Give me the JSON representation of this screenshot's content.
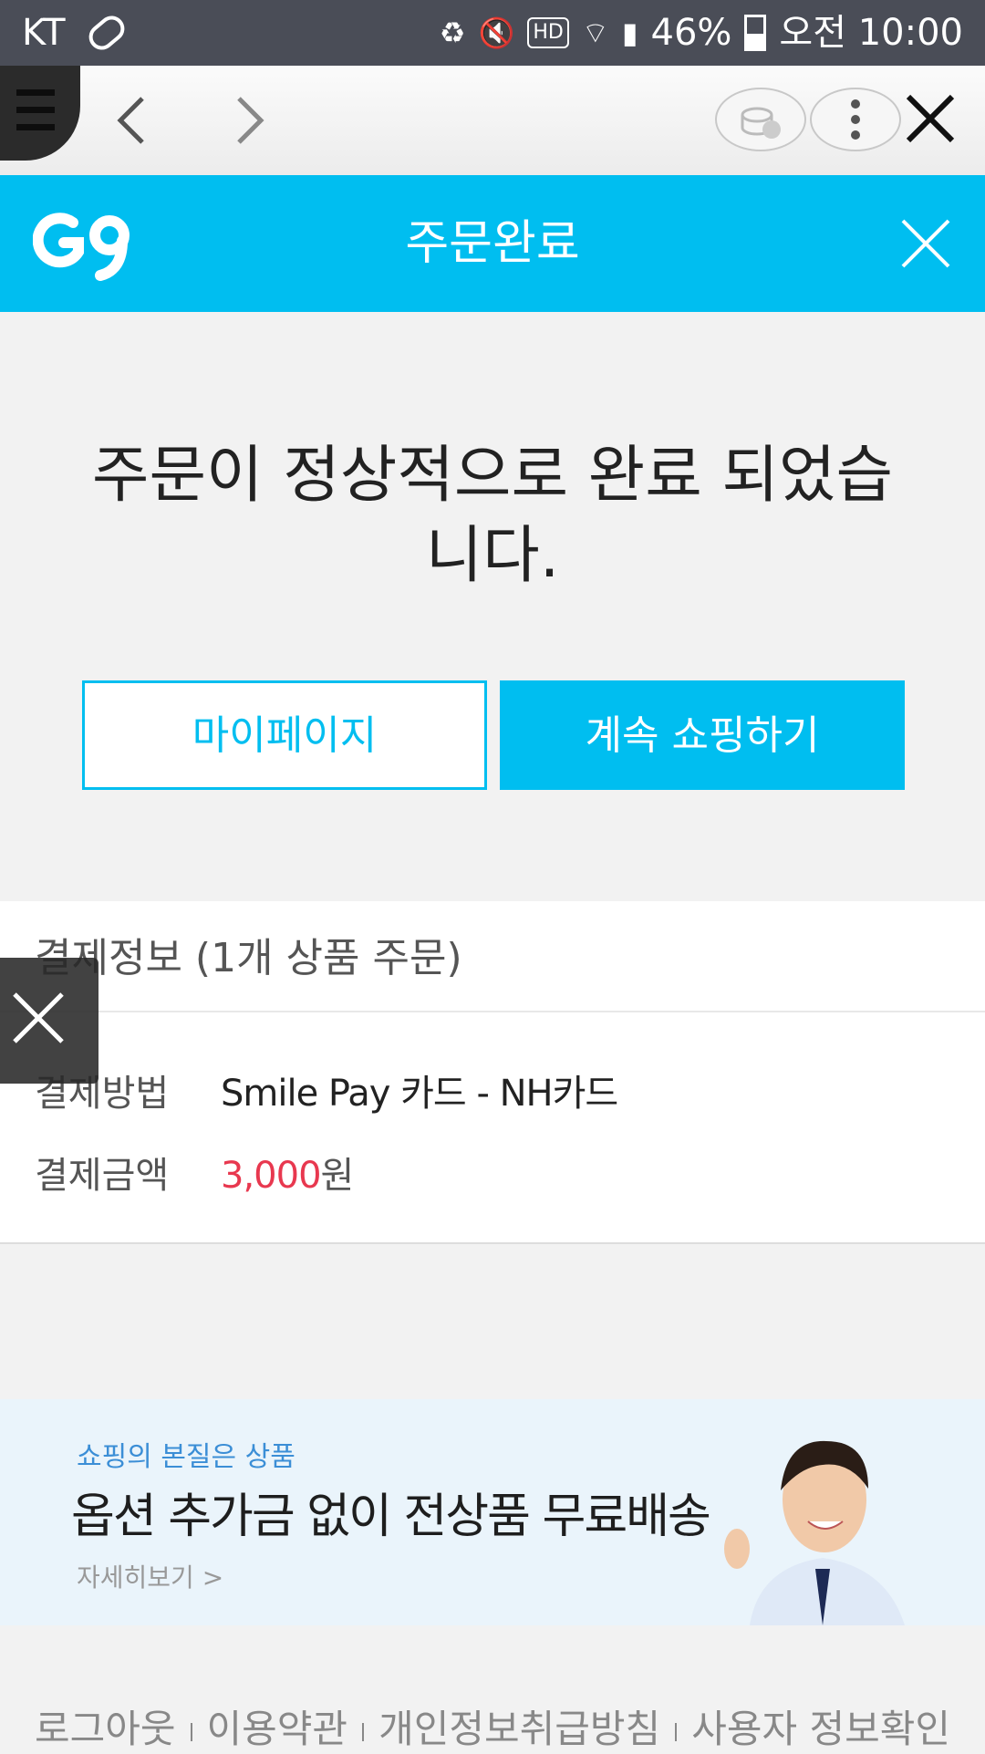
{
  "status": {
    "carrier": "KT",
    "battery": "46%",
    "time": "오전 10:00"
  },
  "header": {
    "logo": "G9",
    "title": "주문완료"
  },
  "message": "주문이 정상적으로 완료 되었습니다.",
  "buttons": {
    "mypage": "마이페이지",
    "continue": "계속 쇼핑하기"
  },
  "payment": {
    "title": "결제정보 (1개 상품 주문)",
    "method_label": "결제방법",
    "method_value": "Smile Pay 카드 - NH카드",
    "amount_label": "결제금액",
    "amount_value": "3,000",
    "amount_unit": "원"
  },
  "banner": {
    "subtitle": "쇼핑의 본질은 상품",
    "headline": "옵션 추가금 없이 전상품 무료배송",
    "more": "자세히보기 >"
  },
  "footer": {
    "links": [
      "로그아웃",
      "이용약관",
      "개인정보취급방침",
      "사용자 정보확인"
    ]
  },
  "colors": {
    "accent": "#00bef0",
    "price": "#e8384f",
    "statusbar": "#4a4d57"
  }
}
